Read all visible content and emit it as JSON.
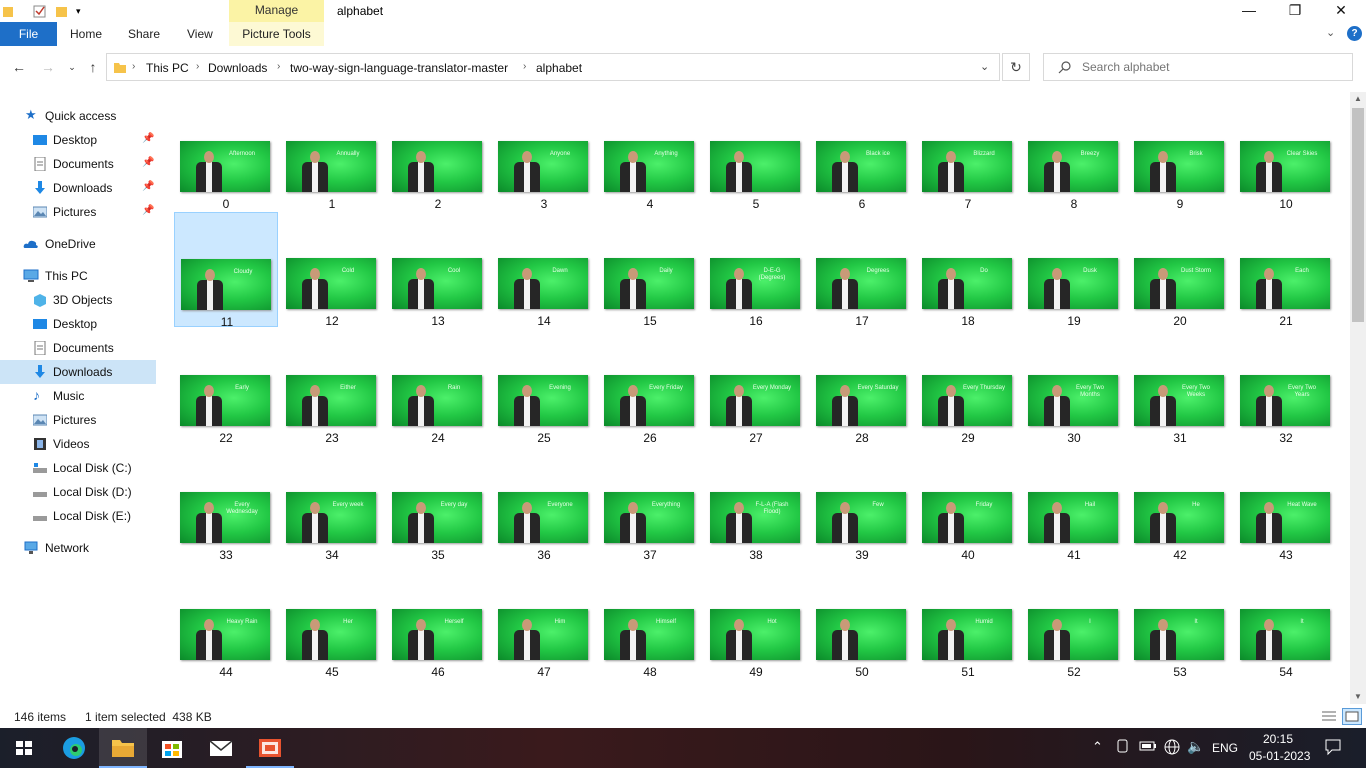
{
  "window": {
    "title": "alphabet",
    "manage_label": "Manage",
    "minimize": "—",
    "maximize": "❐",
    "close": "✕"
  },
  "ribbon": {
    "file": "File",
    "home": "Home",
    "share": "Share",
    "view": "View",
    "picture_tools": "Picture Tools",
    "help": "?"
  },
  "address": {
    "breadcrumbs": [
      "This PC",
      "Downloads",
      "two-way-sign-language-translator-master",
      "alphabet"
    ],
    "search_placeholder": "Search alphabet"
  },
  "nav": {
    "quick_access": "Quick access",
    "quick_items": [
      "Desktop",
      "Documents",
      "Downloads",
      "Pictures"
    ],
    "onedrive": "OneDrive",
    "this_pc": "This PC",
    "pc_items": [
      "3D Objects",
      "Desktop",
      "Documents",
      "Downloads",
      "Music",
      "Pictures",
      "Videos",
      "Local Disk (C:)",
      "Local Disk (D:)",
      "Local Disk (E:)"
    ],
    "network": "Network",
    "selected": "Downloads"
  },
  "files": {
    "selected_index": 11,
    "items": [
      {
        "name": "0",
        "caption": "Afternoon"
      },
      {
        "name": "1",
        "caption": "Annually"
      },
      {
        "name": "2",
        "caption": ""
      },
      {
        "name": "3",
        "caption": "Anyone"
      },
      {
        "name": "4",
        "caption": "Anything"
      },
      {
        "name": "5",
        "caption": ""
      },
      {
        "name": "6",
        "caption": "Black ice"
      },
      {
        "name": "7",
        "caption": "Blizzard"
      },
      {
        "name": "8",
        "caption": "Breezy"
      },
      {
        "name": "9",
        "caption": "Brisk"
      },
      {
        "name": "10",
        "caption": "Clear Skies"
      },
      {
        "name": "11",
        "caption": "Cloudy"
      },
      {
        "name": "12",
        "caption": "Cold"
      },
      {
        "name": "13",
        "caption": "Cool"
      },
      {
        "name": "14",
        "caption": "Dawn"
      },
      {
        "name": "15",
        "caption": "Daily"
      },
      {
        "name": "16",
        "caption": "D-E-G (Degrees)"
      },
      {
        "name": "17",
        "caption": "Degrees"
      },
      {
        "name": "18",
        "caption": "Do"
      },
      {
        "name": "19",
        "caption": "Dusk"
      },
      {
        "name": "20",
        "caption": "Dust Storm"
      },
      {
        "name": "21",
        "caption": "Each"
      },
      {
        "name": "22",
        "caption": "Early"
      },
      {
        "name": "23",
        "caption": "Either"
      },
      {
        "name": "24",
        "caption": "Rain"
      },
      {
        "name": "25",
        "caption": "Evening"
      },
      {
        "name": "26",
        "caption": "Every Friday"
      },
      {
        "name": "27",
        "caption": "Every Monday"
      },
      {
        "name": "28",
        "caption": "Every Saturday"
      },
      {
        "name": "29",
        "caption": "Every Thursday"
      },
      {
        "name": "30",
        "caption": "Every Two Months"
      },
      {
        "name": "31",
        "caption": "Every Two Weeks"
      },
      {
        "name": "32",
        "caption": "Every Two Years"
      },
      {
        "name": "33",
        "caption": "Every Wednesday"
      },
      {
        "name": "34",
        "caption": "Every week"
      },
      {
        "name": "35",
        "caption": "Every day"
      },
      {
        "name": "36",
        "caption": "Everyone"
      },
      {
        "name": "37",
        "caption": "Everything"
      },
      {
        "name": "38",
        "caption": "F-L-A (Flash Flood)"
      },
      {
        "name": "39",
        "caption": "Few"
      },
      {
        "name": "40",
        "caption": "Friday"
      },
      {
        "name": "41",
        "caption": "Hail"
      },
      {
        "name": "42",
        "caption": "He"
      },
      {
        "name": "43",
        "caption": "Heat Wave"
      },
      {
        "name": "44",
        "caption": "Heavy Rain"
      },
      {
        "name": "45",
        "caption": "Her"
      },
      {
        "name": "46",
        "caption": "Herself"
      },
      {
        "name": "47",
        "caption": "Him"
      },
      {
        "name": "48",
        "caption": "Himself"
      },
      {
        "name": "49",
        "caption": "Hot"
      },
      {
        "name": "50",
        "caption": ""
      },
      {
        "name": "51",
        "caption": "Humid"
      },
      {
        "name": "52",
        "caption": "I"
      },
      {
        "name": "53",
        "caption": "It"
      },
      {
        "name": "54",
        "caption": "It"
      }
    ]
  },
  "status": {
    "count": "146 items",
    "selection": "1 item selected  438 KB"
  },
  "taskbar": {
    "lang": "ENG",
    "time": "20:15",
    "date": "05-01-2023"
  },
  "colors": {
    "accent": "#1e6fc8",
    "selection": "#cce8ff",
    "manage_tab": "#fbf3a5"
  }
}
